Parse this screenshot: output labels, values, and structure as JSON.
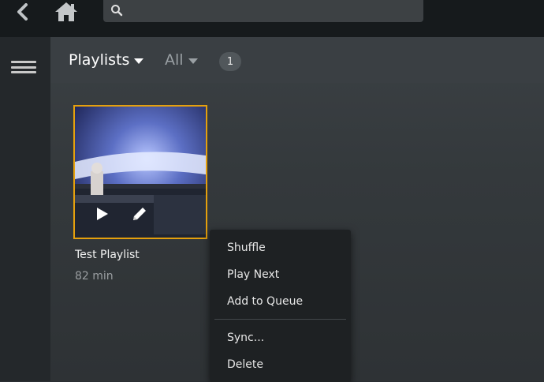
{
  "topbar": {
    "back_icon": "chevron-left-icon",
    "home_icon": "home-icon",
    "search": {
      "icon": "search-icon",
      "placeholder": "",
      "value": ""
    }
  },
  "sidebar": {
    "menu_icon": "hamburger-menu-icon"
  },
  "filters": {
    "primary": "Playlists",
    "secondary": "All",
    "count": "1"
  },
  "playlist": {
    "title": "Test Playlist",
    "duration": "82 min",
    "accent": "#e5a00d",
    "overlay_icons": [
      "play-icon",
      "pencil-edit-icon"
    ]
  },
  "context_menu": {
    "items": [
      "Shuffle",
      "Play Next",
      "Add to Queue",
      "Sync...",
      "Delete"
    ]
  },
  "colors": {
    "topbar": "#161a1c",
    "sidebar": "#24282b",
    "main": "#34393c",
    "menu_bg": "#1e2123"
  }
}
